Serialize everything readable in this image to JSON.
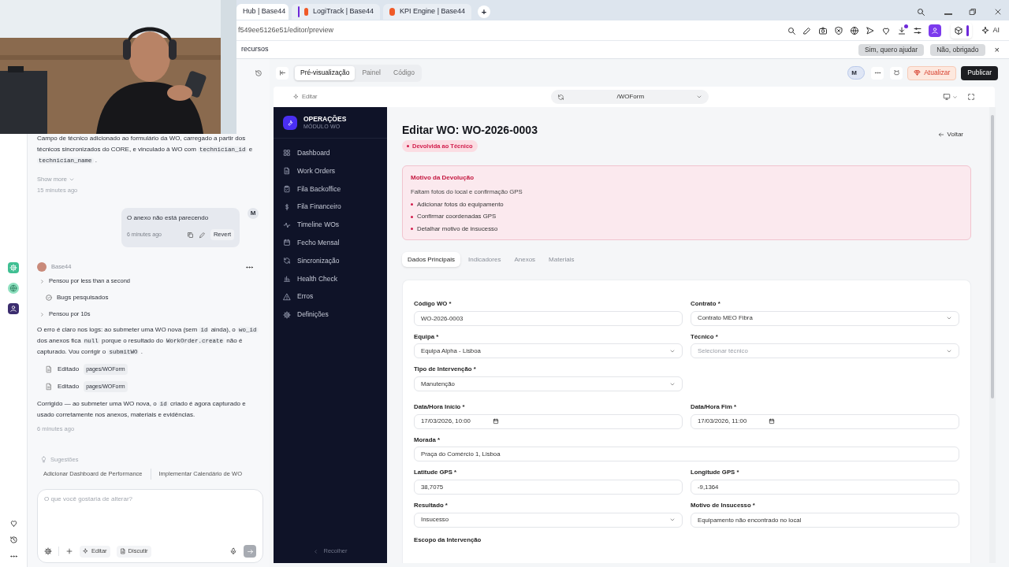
{
  "browser": {
    "tabs": [
      {
        "title": "Hub | Base44",
        "selected": true
      },
      {
        "title": "LogiTrack | Base44",
        "selected": false
      },
      {
        "title": "KPI Engine | Base44",
        "selected": false
      }
    ],
    "new_tab": "+",
    "url": "f549ee5126e51/editor/preview",
    "ai_label": "AI",
    "infobar": {
      "text": "recursos",
      "buttons": [
        "Sim, quero ajudar",
        "Não, obrigado"
      ],
      "close": "×"
    }
  },
  "chat": {
    "items": [
      {
        "kind": "paragraph",
        "segments": [
          {
            "text": "Campo de técnico adicionado ao formulário da WO, carregado a partir dos técnicos sincronizados do CORE, e vinculado à WO com ",
            "code": false
          },
          {
            "text": "technician_id",
            "code": true
          },
          {
            "text": " e ",
            "code": false
          },
          {
            "text": "technician_name",
            "code": true
          },
          {
            "text": " .",
            "code": false
          }
        ]
      },
      {
        "kind": "show_more",
        "text": "Show more"
      },
      {
        "kind": "time",
        "text": "15 minutes ago"
      },
      {
        "kind": "user_message",
        "text": "O anexo não está parecendo",
        "time": "6 minutes ago",
        "action": "Revert",
        "avatar": "M"
      },
      {
        "kind": "assistant_header",
        "text": "Base44"
      },
      {
        "kind": "thought",
        "text": "Pensou por less than a second"
      },
      {
        "kind": "task",
        "text": "Bugs pesquisados"
      },
      {
        "kind": "thought",
        "text": "Pensou por 10s"
      },
      {
        "kind": "paragraph",
        "segments": [
          {
            "text": "O erro é claro nos logs: ao submeter uma WO nova (sem ",
            "code": false
          },
          {
            "text": "id",
            "code": true
          },
          {
            "text": " ainda), o ",
            "code": false
          },
          {
            "text": "wo_id",
            "code": true
          },
          {
            "text": " dos anexos fica ",
            "code": false
          },
          {
            "text": "null",
            "code": true
          },
          {
            "text": " porque o resultado do ",
            "code": false
          },
          {
            "text": "WorkOrder.create",
            "code": true
          },
          {
            "text": " não é capturado. Vou corrigir o ",
            "code": false
          },
          {
            "text": "submitWO",
            "code": true
          },
          {
            "text": " .",
            "code": false
          }
        ]
      },
      {
        "kind": "edit",
        "text": "Editado",
        "file": "pages/WOForm"
      },
      {
        "kind": "edit",
        "text": "Editado",
        "file": "pages/WOForm"
      },
      {
        "kind": "paragraph",
        "segments": [
          {
            "text": "Corrigido — ao submeter uma WO nova, o ",
            "code": false
          },
          {
            "text": "id",
            "code": true
          },
          {
            "text": " criado é agora capturado e usado corretamente nos anexos, materiais e evidências.",
            "code": false
          }
        ]
      },
      {
        "kind": "time",
        "text": "6 minutes ago"
      }
    ],
    "suggestions_title": "Sugestões",
    "suggestions": [
      "Adicionar Dashboard de Performance",
      "Implementar Calendário de WO"
    ],
    "composer": {
      "placeholder": "O que você gostaria de alterar?",
      "modes": [
        "Editar",
        "Discutir"
      ]
    }
  },
  "editor": {
    "view_tabs": [
      {
        "label": "Pré-visualização",
        "selected": true
      },
      {
        "label": "Painel",
        "selected": false
      },
      {
        "label": "Código",
        "selected": false
      }
    ],
    "avatar": "M",
    "upgrade": "Atualizar",
    "publish": "Publicar",
    "edit_label": "Editar",
    "route": "/WOForm"
  },
  "app": {
    "brand": {
      "title": "OPERAÇÕES",
      "subtitle": "MÓDULO WO"
    },
    "nav": [
      "Dashboard",
      "Work Orders",
      "Fila Backoffice",
      "Fila Financeiro",
      "Timeline WOs",
      "Fecho Mensal",
      "Sincronização",
      "Health Check",
      "Erros",
      "Definições"
    ],
    "collapse": "Recolher",
    "title": "Editar WO: WO-2026-0003",
    "status": "Devolvida ao Técnico",
    "back": "Voltar",
    "alert": {
      "title": "Motivo da Devolução",
      "text": "Faltam fotos do local e confirmação GPS",
      "items": [
        "Adicionar fotos do equipamento",
        "Confirmar coordenadas GPS",
        "Detalhar motivo de insucesso"
      ]
    },
    "tabs": [
      {
        "label": "Dados Principais",
        "selected": true
      },
      {
        "label": "Indicadores",
        "selected": false
      },
      {
        "label": "Anexos",
        "selected": false
      },
      {
        "label": "Materiais",
        "selected": false
      }
    ],
    "form": [
      [
        {
          "label": "Código WO *",
          "kind": "text",
          "value": "WO-2026-0003"
        },
        {
          "label": "Contrato *",
          "kind": "select",
          "value": "Contrato MEO Fibra"
        }
      ],
      [
        {
          "label": "Equipa *",
          "kind": "select",
          "value": "Equipa Alpha - Lisboa"
        },
        {
          "label": "Técnico *",
          "kind": "select",
          "placeholder": "Selecionar técnico"
        }
      ],
      [
        {
          "label": "Tipo de Intervenção *",
          "kind": "select",
          "value": "Manutenção"
        }
      ],
      [
        {
          "label": "Data/Hora Início *",
          "kind": "date",
          "value": "17/03/2026, 10:00"
        },
        {
          "label": "Data/Hora Fim *",
          "kind": "date",
          "value": "17/03/2026, 11:00"
        }
      ],
      [
        {
          "label": "Morada *",
          "kind": "text",
          "value": "Praça do Comércio 1, Lisboa",
          "full_width": true
        }
      ],
      [
        {
          "label": "Latitude GPS *",
          "kind": "text",
          "value": "38,7075"
        },
        {
          "label": "Longitude GPS *",
          "kind": "text",
          "value": "-9,1364"
        }
      ],
      [
        {
          "label": "Resultado *",
          "kind": "select",
          "value": "Insucesso"
        },
        {
          "label": "Motivo de Insucesso *",
          "kind": "text",
          "value": "Equipamento não encontrado no local"
        }
      ]
    ],
    "next_label": "Escopo da Intervenção"
  }
}
